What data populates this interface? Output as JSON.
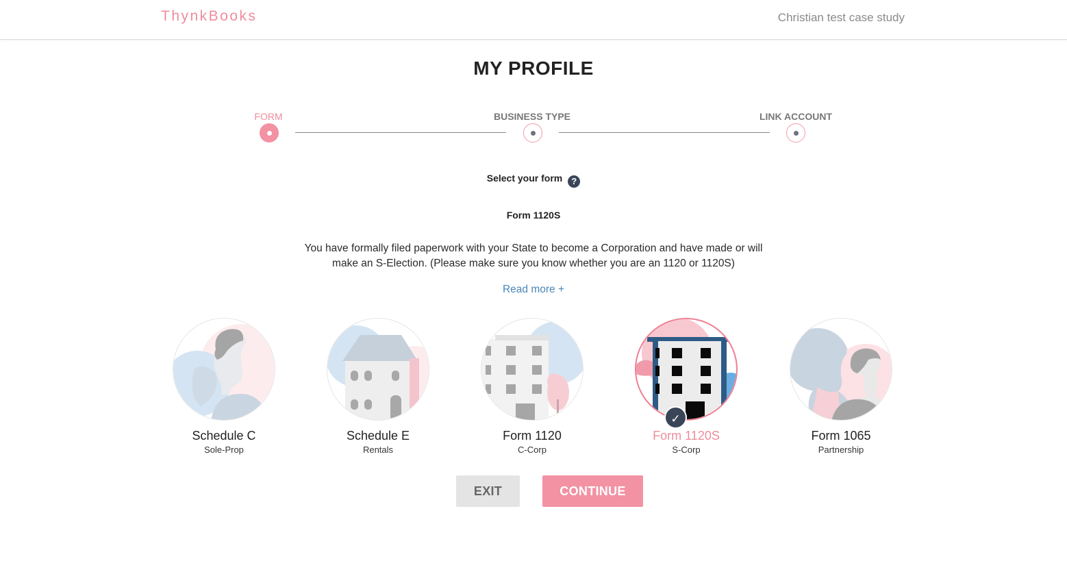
{
  "header": {
    "logo_text": "ThynkBooks",
    "user_name": "Christian test case study"
  },
  "page": {
    "title": "MY PROFILE"
  },
  "stepper": {
    "steps": [
      {
        "label": "FORM",
        "state": "active"
      },
      {
        "label": "BUSINESS TYPE",
        "state": "pending"
      },
      {
        "label": "LINK ACCOUNT",
        "state": "pending"
      }
    ]
  },
  "form_select": {
    "label": "Select your form",
    "help_icon": "question-mark-icon",
    "selected_form_name": "Form 1120S",
    "description": "You have formally filed paperwork with your State to become a Corporation and have made or will make an S-Election. (Please make sure you know whether you are an 1120 or 1120S)",
    "read_more": "Read more +"
  },
  "options": [
    {
      "title": "Schedule C",
      "subtitle": "Sole-Prop",
      "icon": "person-profile-icon",
      "selected": false
    },
    {
      "title": "Schedule E",
      "subtitle": "Rentals",
      "icon": "house-icon",
      "selected": false
    },
    {
      "title": "Form 1120",
      "subtitle": "C-Corp",
      "icon": "building-tree-icon",
      "selected": false
    },
    {
      "title": "Form 1120S",
      "subtitle": "S-Corp",
      "icon": "office-building-icon",
      "selected": true
    },
    {
      "title": "Form 1065",
      "subtitle": "Partnership",
      "icon": "two-people-icon",
      "selected": false
    }
  ],
  "buttons": {
    "exit": "EXIT",
    "continue": "CONTINUE"
  },
  "colors": {
    "accent": "#f292a3",
    "dark_badge": "#3a4658",
    "link": "#4a86b8"
  }
}
